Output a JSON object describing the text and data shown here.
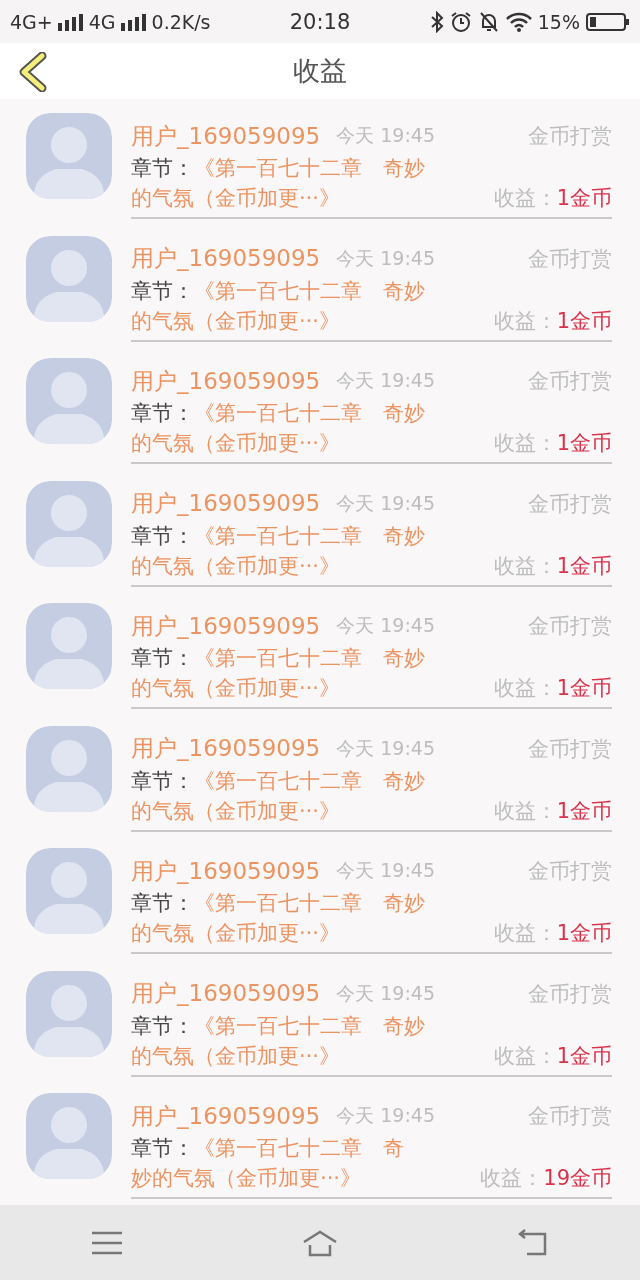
{
  "status_bar": {
    "network_1": "4G+",
    "network_2": "4G",
    "speed": "0.2K/s",
    "time": "20:18",
    "battery": "15%"
  },
  "header": {
    "title": "收益"
  },
  "records": [
    {
      "user": "用户_169059095",
      "time": "今天 19:45",
      "type": "金币打赏",
      "chapter_label": "章节：",
      "chapter_lines": [
        "《第一百七十二章　奇妙",
        "的气氛（金币加更···》"
      ],
      "income_label": "收益：",
      "income": "1金币"
    },
    {
      "user": "用户_169059095",
      "time": "今天 19:45",
      "type": "金币打赏",
      "chapter_label": "章节：",
      "chapter_lines": [
        "《第一百七十二章　奇妙",
        "的气氛（金币加更···》"
      ],
      "income_label": "收益：",
      "income": "1金币"
    },
    {
      "user": "用户_169059095",
      "time": "今天 19:45",
      "type": "金币打赏",
      "chapter_label": "章节：",
      "chapter_lines": [
        "《第一百七十二章　奇妙",
        "的气氛（金币加更···》"
      ],
      "income_label": "收益：",
      "income": "1金币"
    },
    {
      "user": "用户_169059095",
      "time": "今天 19:45",
      "type": "金币打赏",
      "chapter_label": "章节：",
      "chapter_lines": [
        "《第一百七十二章　奇妙",
        "的气氛（金币加更···》"
      ],
      "income_label": "收益：",
      "income": "1金币"
    },
    {
      "user": "用户_169059095",
      "time": "今天 19:45",
      "type": "金币打赏",
      "chapter_label": "章节：",
      "chapter_lines": [
        "《第一百七十二章　奇妙",
        "的气氛（金币加更···》"
      ],
      "income_label": "收益：",
      "income": "1金币"
    },
    {
      "user": "用户_169059095",
      "time": "今天 19:45",
      "type": "金币打赏",
      "chapter_label": "章节：",
      "chapter_lines": [
        "《第一百七十二章　奇妙",
        "的气氛（金币加更···》"
      ],
      "income_label": "收益：",
      "income": "1金币"
    },
    {
      "user": "用户_169059095",
      "time": "今天 19:45",
      "type": "金币打赏",
      "chapter_label": "章节：",
      "chapter_lines": [
        "《第一百七十二章　奇妙",
        "的气氛（金币加更···》"
      ],
      "income_label": "收益：",
      "income": "1金币"
    },
    {
      "user": "用户_169059095",
      "time": "今天 19:45",
      "type": "金币打赏",
      "chapter_label": "章节：",
      "chapter_lines": [
        "《第一百七十二章　奇妙",
        "的气氛（金币加更···》"
      ],
      "income_label": "收益：",
      "income": "1金币"
    },
    {
      "user": "用户_169059095",
      "time": "今天 19:45",
      "type": "金币打赏",
      "chapter_label": "章节：",
      "chapter_lines": [
        "《第一百七十二章　奇",
        "妙的气氛（金币加更···》"
      ],
      "income_label": "收益：",
      "income": "19金币"
    }
  ]
}
